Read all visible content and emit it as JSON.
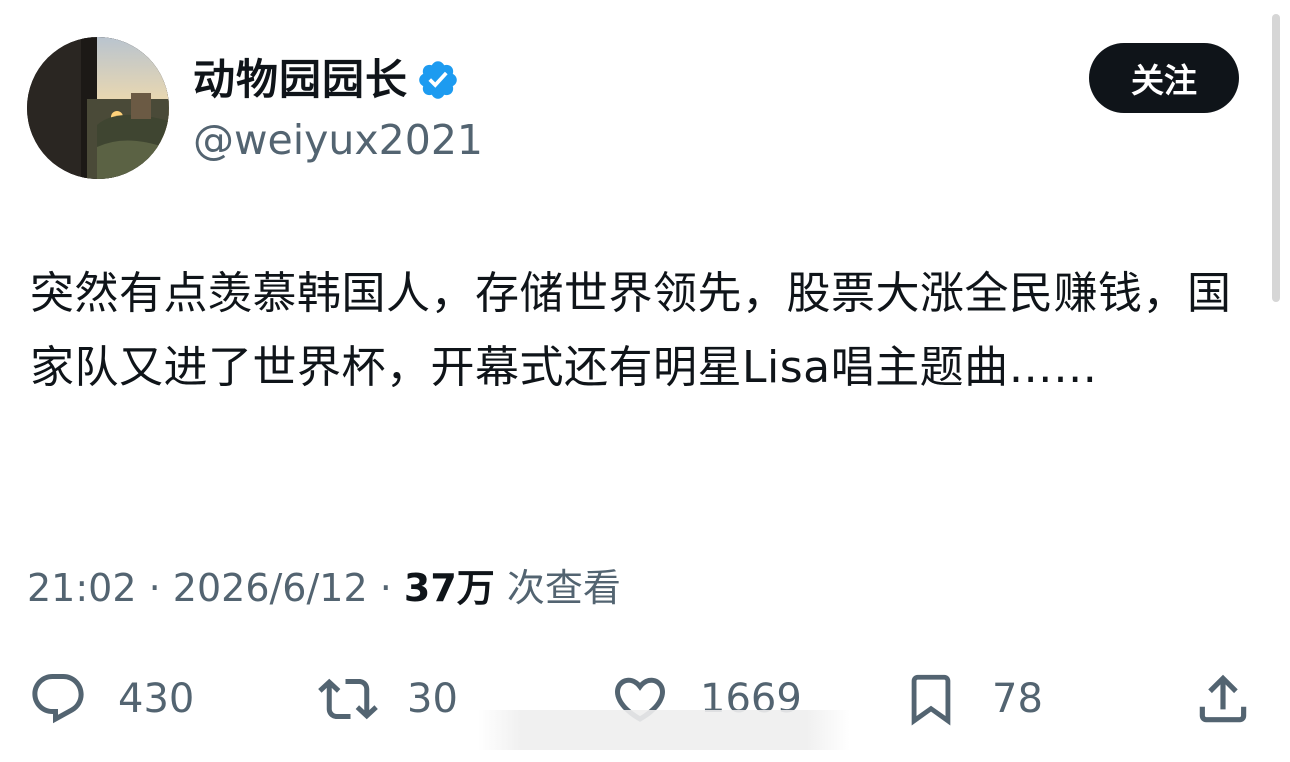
{
  "user": {
    "display_name": "动物园园长",
    "handle": "@weiyux2021",
    "verified_icon": "verified-badge-icon",
    "avatar_icon": "avatar-photo"
  },
  "follow_button": {
    "label": "关注"
  },
  "tweet": {
    "text": "突然有点羡慕韩国人，存储世界领先，股票大涨全民赚钱，国家队又进了世界杯，开幕式还有明星Lisa唱主题曲……"
  },
  "meta": {
    "time": "21:02",
    "separator": "·",
    "date": "2026/6/12",
    "views_count": "37万",
    "views_label": "次查看"
  },
  "actions": {
    "reply": {
      "icon": "reply-icon",
      "count": "430"
    },
    "retweet": {
      "icon": "retweet-icon",
      "count": "30"
    },
    "like": {
      "icon": "heart-icon",
      "count": "1669"
    },
    "bookmark": {
      "icon": "bookmark-icon",
      "count": "78"
    },
    "share": {
      "icon": "share-icon"
    }
  },
  "colors": {
    "text_primary": "#0f1419",
    "text_secondary": "#536471",
    "verified_blue": "#1d9bf0",
    "button_bg": "#0f1419",
    "button_text": "#ffffff"
  }
}
